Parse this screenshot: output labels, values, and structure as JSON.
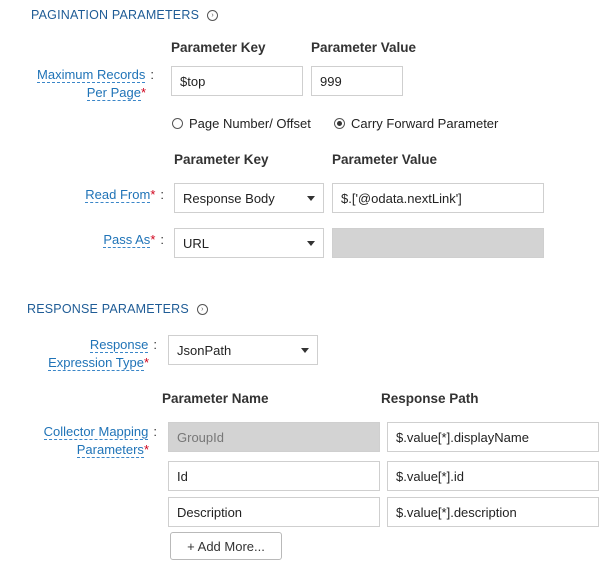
{
  "pagination": {
    "title": "PAGINATION PARAMETERS",
    "info_icon": "info-circle-icon",
    "col_key": "Parameter Key",
    "col_value": "Parameter Value",
    "max_records_label_1": "Maximum Records",
    "max_records_label_2": "Per Page",
    "max_records_key": "$top",
    "max_records_value": "999",
    "radio_page_offset": "Page Number/ Offset",
    "radio_carry_forward": "Carry Forward Parameter",
    "selected_radio": "Carry Forward Parameter",
    "col_key_2": "Parameter Key",
    "col_value_2": "Parameter Value",
    "read_from_label": "Read From",
    "read_from_select": "Response Body",
    "read_from_value": "$.['@odata.nextLink']",
    "pass_as_label": "Pass As",
    "pass_as_select": "URL",
    "pass_as_value": ""
  },
  "response": {
    "title": "RESPONSE PARAMETERS",
    "info_icon": "info-circle-icon",
    "expr_label_1": "Response",
    "expr_label_2": "Expression Type",
    "expr_select": "JsonPath",
    "col_name": "Parameter Name",
    "col_path": "Response Path",
    "collector_label_1": "Collector Mapping",
    "collector_label_2": "Parameters",
    "rows": [
      {
        "name": "GroupId",
        "path": "$.value[*].displayName",
        "name_disabled": true
      },
      {
        "name": "Id",
        "path": "$.value[*].id",
        "name_disabled": false
      },
      {
        "name": "Description",
        "path": "$.value[*].description",
        "name_disabled": false
      }
    ],
    "add_more": "+ Add More..."
  },
  "colors": {
    "section_title": "#1f5c96",
    "label_link": "#1f73b7",
    "required_star": "#d0021b",
    "disabled_field": "#d3d3d3"
  }
}
